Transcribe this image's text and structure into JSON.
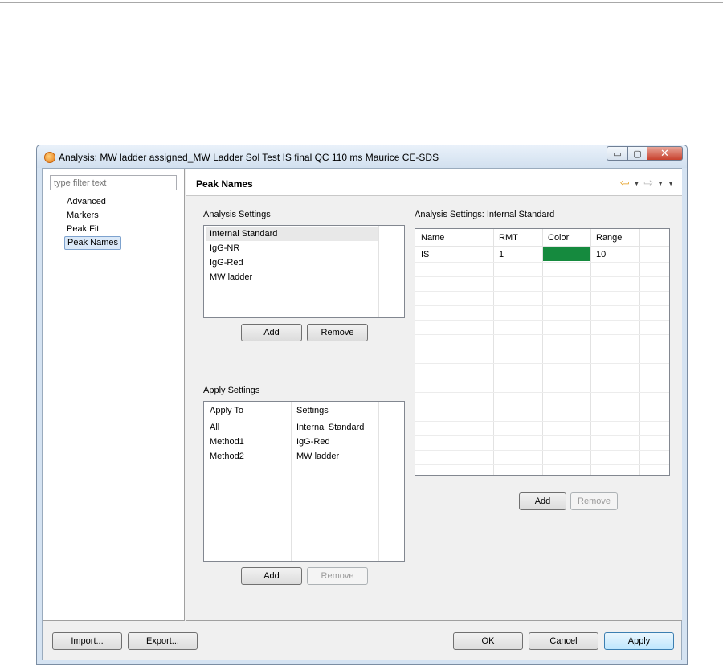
{
  "window": {
    "title": "Analysis: MW ladder assigned_MW Ladder Sol Test IS final QC 110 ms Maurice CE-SDS",
    "minimize_glyph": "▭",
    "maximize_glyph": "▢",
    "close_glyph": "✕"
  },
  "filter": {
    "placeholder": "type filter text"
  },
  "nav": {
    "items": [
      {
        "label": "Advanced"
      },
      {
        "label": "Markers"
      },
      {
        "label": "Peak Fit"
      },
      {
        "label": "Peak Names",
        "selected": true
      }
    ]
  },
  "page": {
    "title": "Peak Names",
    "nav_icons": [
      "back-arrow-icon",
      "dropdown-icon",
      "forward-arrow-icon",
      "dropdown-icon",
      "view-menu-icon"
    ],
    "back_glyph": "⇦",
    "forward_glyph": "⇨",
    "dropdown_glyph": "▼"
  },
  "analysis_settings": {
    "label": "Analysis Settings",
    "items": [
      "Internal Standard",
      "IgG-NR",
      "IgG-Red",
      "MW ladder"
    ],
    "selected_index": 0,
    "add_label": "Add",
    "remove_label": "Remove"
  },
  "apply_settings": {
    "label": "Apply Settings",
    "columns": [
      "Apply To",
      "Settings"
    ],
    "rows": [
      {
        "apply_to": "All",
        "settings": "Internal Standard"
      },
      {
        "apply_to": "Method1",
        "settings": "IgG-Red"
      },
      {
        "apply_to": "Method2",
        "settings": "MW ladder"
      }
    ],
    "add_label": "Add",
    "remove_label": "Remove"
  },
  "detail": {
    "label": "Analysis Settings: Internal Standard",
    "columns": [
      "Name",
      "RMT",
      "Color",
      "Range"
    ],
    "rows": [
      {
        "name": "IS",
        "rmt": "1",
        "color": "#158a3e",
        "range": "10"
      }
    ],
    "add_label": "Add",
    "remove_label": "Remove"
  },
  "footer": {
    "import_label": "Import...",
    "export_label": "Export...",
    "ok_label": "OK",
    "cancel_label": "Cancel",
    "apply_label": "Apply"
  }
}
